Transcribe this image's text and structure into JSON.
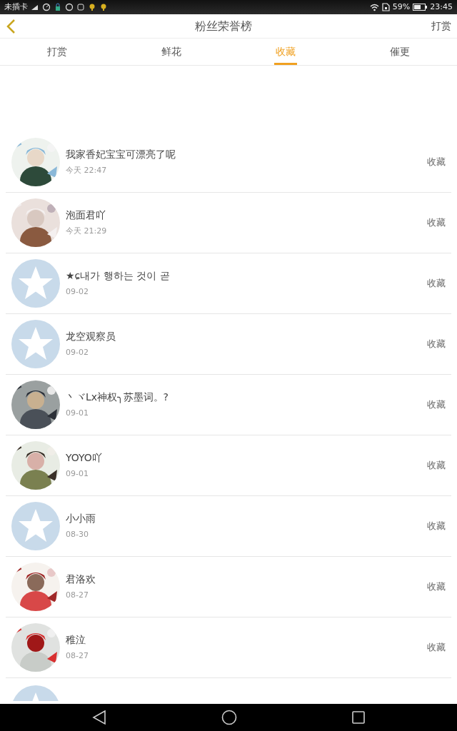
{
  "status_bar": {
    "carrier": "未插卡",
    "battery": "59%",
    "time": "23:45"
  },
  "header": {
    "title": "粉丝荣誉榜",
    "action": "打赏"
  },
  "tabs": [
    {
      "label": "打赏",
      "selected": false
    },
    {
      "label": "鲜花",
      "selected": false
    },
    {
      "label": "收藏",
      "selected": true
    },
    {
      "label": "催更",
      "selected": false
    }
  ],
  "rows": [
    {
      "kind": "picture",
      "name": "我家香妃宝宝可漂亮了呢",
      "time": "今天 22:47",
      "action": "收藏"
    },
    {
      "kind": "picture",
      "name": "泡面君吖",
      "time": "今天 21:29",
      "action": "收藏"
    },
    {
      "kind": "default",
      "name": "★ɕ내가 행하는 것이 곧",
      "time": "09-02",
      "action": "收藏"
    },
    {
      "kind": "default",
      "name": "龙空观察员",
      "time": "09-02",
      "action": "收藏"
    },
    {
      "kind": "picture",
      "name": "丶ヾLx神权╮苏墨词。?",
      "time": "09-01",
      "action": "收藏"
    },
    {
      "kind": "picture",
      "name": "YOYO吖",
      "time": "09-01",
      "action": "收藏"
    },
    {
      "kind": "default",
      "name": "小小雨",
      "time": "08-30",
      "action": "收藏"
    },
    {
      "kind": "picture",
      "name": "君洛欢",
      "time": "08-27",
      "action": "收藏"
    },
    {
      "kind": "picture",
      "name": "稚泣",
      "time": "08-27",
      "action": "收藏"
    },
    {
      "kind": "default"
    }
  ]
}
